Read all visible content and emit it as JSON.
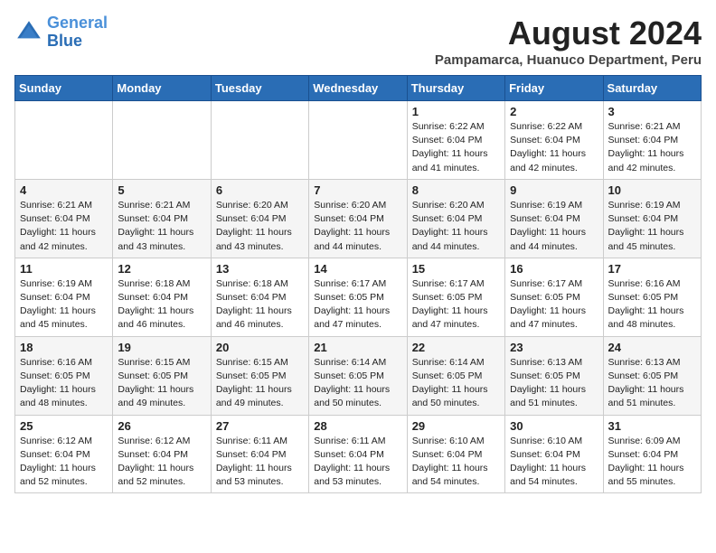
{
  "header": {
    "logo_line1": "General",
    "logo_line2": "Blue",
    "month": "August 2024",
    "location": "Pampamarca, Huanuco Department, Peru"
  },
  "weekdays": [
    "Sunday",
    "Monday",
    "Tuesday",
    "Wednesday",
    "Thursday",
    "Friday",
    "Saturday"
  ],
  "weeks": [
    [
      {
        "day": "",
        "info": ""
      },
      {
        "day": "",
        "info": ""
      },
      {
        "day": "",
        "info": ""
      },
      {
        "day": "",
        "info": ""
      },
      {
        "day": "1",
        "info": "Sunrise: 6:22 AM\nSunset: 6:04 PM\nDaylight: 11 hours\nand 41 minutes."
      },
      {
        "day": "2",
        "info": "Sunrise: 6:22 AM\nSunset: 6:04 PM\nDaylight: 11 hours\nand 42 minutes."
      },
      {
        "day": "3",
        "info": "Sunrise: 6:21 AM\nSunset: 6:04 PM\nDaylight: 11 hours\nand 42 minutes."
      }
    ],
    [
      {
        "day": "4",
        "info": "Sunrise: 6:21 AM\nSunset: 6:04 PM\nDaylight: 11 hours\nand 42 minutes."
      },
      {
        "day": "5",
        "info": "Sunrise: 6:21 AM\nSunset: 6:04 PM\nDaylight: 11 hours\nand 43 minutes."
      },
      {
        "day": "6",
        "info": "Sunrise: 6:20 AM\nSunset: 6:04 PM\nDaylight: 11 hours\nand 43 minutes."
      },
      {
        "day": "7",
        "info": "Sunrise: 6:20 AM\nSunset: 6:04 PM\nDaylight: 11 hours\nand 44 minutes."
      },
      {
        "day": "8",
        "info": "Sunrise: 6:20 AM\nSunset: 6:04 PM\nDaylight: 11 hours\nand 44 minutes."
      },
      {
        "day": "9",
        "info": "Sunrise: 6:19 AM\nSunset: 6:04 PM\nDaylight: 11 hours\nand 44 minutes."
      },
      {
        "day": "10",
        "info": "Sunrise: 6:19 AM\nSunset: 6:04 PM\nDaylight: 11 hours\nand 45 minutes."
      }
    ],
    [
      {
        "day": "11",
        "info": "Sunrise: 6:19 AM\nSunset: 6:04 PM\nDaylight: 11 hours\nand 45 minutes."
      },
      {
        "day": "12",
        "info": "Sunrise: 6:18 AM\nSunset: 6:04 PM\nDaylight: 11 hours\nand 46 minutes."
      },
      {
        "day": "13",
        "info": "Sunrise: 6:18 AM\nSunset: 6:04 PM\nDaylight: 11 hours\nand 46 minutes."
      },
      {
        "day": "14",
        "info": "Sunrise: 6:17 AM\nSunset: 6:05 PM\nDaylight: 11 hours\nand 47 minutes."
      },
      {
        "day": "15",
        "info": "Sunrise: 6:17 AM\nSunset: 6:05 PM\nDaylight: 11 hours\nand 47 minutes."
      },
      {
        "day": "16",
        "info": "Sunrise: 6:17 AM\nSunset: 6:05 PM\nDaylight: 11 hours\nand 47 minutes."
      },
      {
        "day": "17",
        "info": "Sunrise: 6:16 AM\nSunset: 6:05 PM\nDaylight: 11 hours\nand 48 minutes."
      }
    ],
    [
      {
        "day": "18",
        "info": "Sunrise: 6:16 AM\nSunset: 6:05 PM\nDaylight: 11 hours\nand 48 minutes."
      },
      {
        "day": "19",
        "info": "Sunrise: 6:15 AM\nSunset: 6:05 PM\nDaylight: 11 hours\nand 49 minutes."
      },
      {
        "day": "20",
        "info": "Sunrise: 6:15 AM\nSunset: 6:05 PM\nDaylight: 11 hours\nand 49 minutes."
      },
      {
        "day": "21",
        "info": "Sunrise: 6:14 AM\nSunset: 6:05 PM\nDaylight: 11 hours\nand 50 minutes."
      },
      {
        "day": "22",
        "info": "Sunrise: 6:14 AM\nSunset: 6:05 PM\nDaylight: 11 hours\nand 50 minutes."
      },
      {
        "day": "23",
        "info": "Sunrise: 6:13 AM\nSunset: 6:05 PM\nDaylight: 11 hours\nand 51 minutes."
      },
      {
        "day": "24",
        "info": "Sunrise: 6:13 AM\nSunset: 6:05 PM\nDaylight: 11 hours\nand 51 minutes."
      }
    ],
    [
      {
        "day": "25",
        "info": "Sunrise: 6:12 AM\nSunset: 6:04 PM\nDaylight: 11 hours\nand 52 minutes."
      },
      {
        "day": "26",
        "info": "Sunrise: 6:12 AM\nSunset: 6:04 PM\nDaylight: 11 hours\nand 52 minutes."
      },
      {
        "day": "27",
        "info": "Sunrise: 6:11 AM\nSunset: 6:04 PM\nDaylight: 11 hours\nand 53 minutes."
      },
      {
        "day": "28",
        "info": "Sunrise: 6:11 AM\nSunset: 6:04 PM\nDaylight: 11 hours\nand 53 minutes."
      },
      {
        "day": "29",
        "info": "Sunrise: 6:10 AM\nSunset: 6:04 PM\nDaylight: 11 hours\nand 54 minutes."
      },
      {
        "day": "30",
        "info": "Sunrise: 6:10 AM\nSunset: 6:04 PM\nDaylight: 11 hours\nand 54 minutes."
      },
      {
        "day": "31",
        "info": "Sunrise: 6:09 AM\nSunset: 6:04 PM\nDaylight: 11 hours\nand 55 minutes."
      }
    ]
  ]
}
